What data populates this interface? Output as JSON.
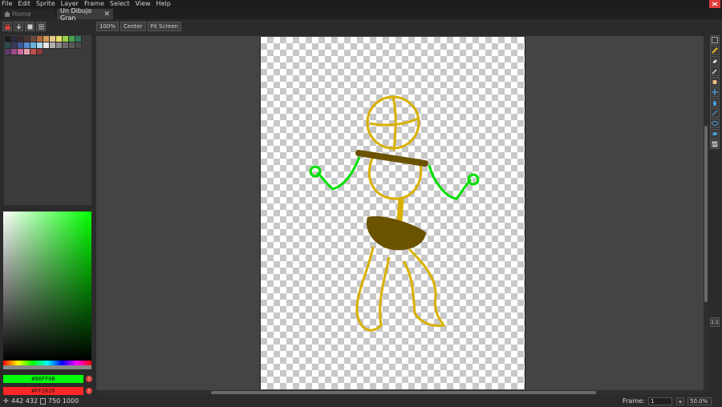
{
  "menu": [
    "File",
    "Edit",
    "Sprite",
    "Layer",
    "Frame",
    "Select",
    "View",
    "Help"
  ],
  "tabs": {
    "home": "Home",
    "document": "Un Dibujo Gran"
  },
  "editor_toolbar": {
    "zoom_100": "100%",
    "center": "Center",
    "fit": "Fit Screen"
  },
  "palette": [
    "#1b1b1b",
    "#2a2a3a",
    "#3a2630",
    "#4a3432",
    "#6d4a3a",
    "#b06a40",
    "#d89a5a",
    "#e8c88c",
    "#e6e06a",
    "#9ad04a",
    "#4aa050",
    "#2e7a5a",
    "#2a4a4a",
    "#3a3a5a",
    "#3a5aa0",
    "#5a8ad0",
    "#6ab0e0",
    "#a8d8ea",
    "#e8e8e8",
    "#b0b0b0",
    "#8a8a8a",
    "#6a6a6a",
    "#5a5a5a",
    "#4a4a4a",
    "#5a3a6a",
    "#9a4a8a",
    "#d06aa0",
    "#e0a0b0",
    "#c05050",
    "#8a3a3a"
  ],
  "colors": {
    "foreground": "#00FF0B",
    "background": "#FF2626"
  },
  "status": {
    "position": "442 432",
    "size": "750 1000",
    "frame_label": "Frame:",
    "frame_value": "1",
    "zoom": "50.0%"
  },
  "tool_icons": [
    "marquee-icon",
    "pencil-icon",
    "eraser-icon",
    "eyedropper-icon",
    "hand-icon",
    "move-icon",
    "fill-icon",
    "line-icon",
    "ellipse-icon",
    "blob-icon",
    "contour-icon"
  ],
  "zoom_reset_label": "1:1"
}
